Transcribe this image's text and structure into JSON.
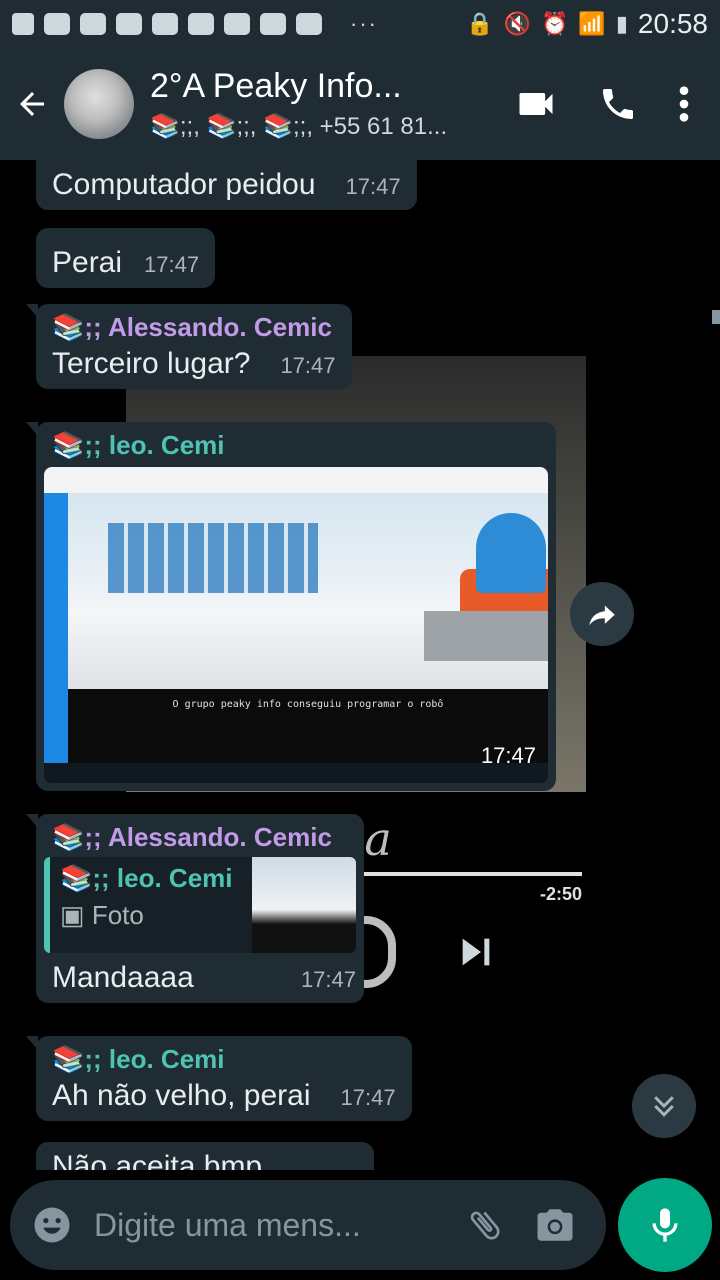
{
  "status_bar": {
    "time": "20:58",
    "dots": "···",
    "icons": [
      "notification-icon",
      "app-icons",
      "mute-icon",
      "alarm-icon",
      "wifi-icon",
      "signal-icon",
      "battery-icon"
    ]
  },
  "header": {
    "title": "2°A Peaky Info...",
    "subtitle": "📚;;, 📚;;, 📚;;, +55 61 81...",
    "icons": [
      "back-arrow-icon",
      "video-call-icon",
      "phone-icon",
      "more-vert-icon"
    ]
  },
  "messages": [
    {
      "text": "Computador peidou",
      "time": "17:47"
    },
    {
      "text": "Perai",
      "time": "17:47"
    },
    {
      "sender": "📚;; Alessando. Cemic",
      "text": "Terceiro lugar?",
      "time": "17:47"
    },
    {
      "sender": "📚;; leo. Cemi",
      "media_caption": "O grupo peaky info  conseguiu programar o robô",
      "time": "17:47"
    },
    {
      "sender": "📚;; Alessando. Cemic",
      "quote_sender": "📚;; leo. Cemi",
      "quote_type": "Foto",
      "text": "Mandaaaa",
      "time": "17:47"
    },
    {
      "sender": "📚;; leo. Cemi",
      "text": "Ah não velho, perai",
      "time": "17:47"
    },
    {
      "text": "Não aceita bmp"
    }
  ],
  "background": {
    "text": "nia",
    "time": "-2:50"
  },
  "input": {
    "placeholder": "Digite uma mens..."
  },
  "colors": {
    "bubble": "#1f2c34",
    "header": "#1f2c34",
    "accent": "#00a884",
    "sender_purple": "#c29be8",
    "sender_teal": "#4fc3b2"
  }
}
